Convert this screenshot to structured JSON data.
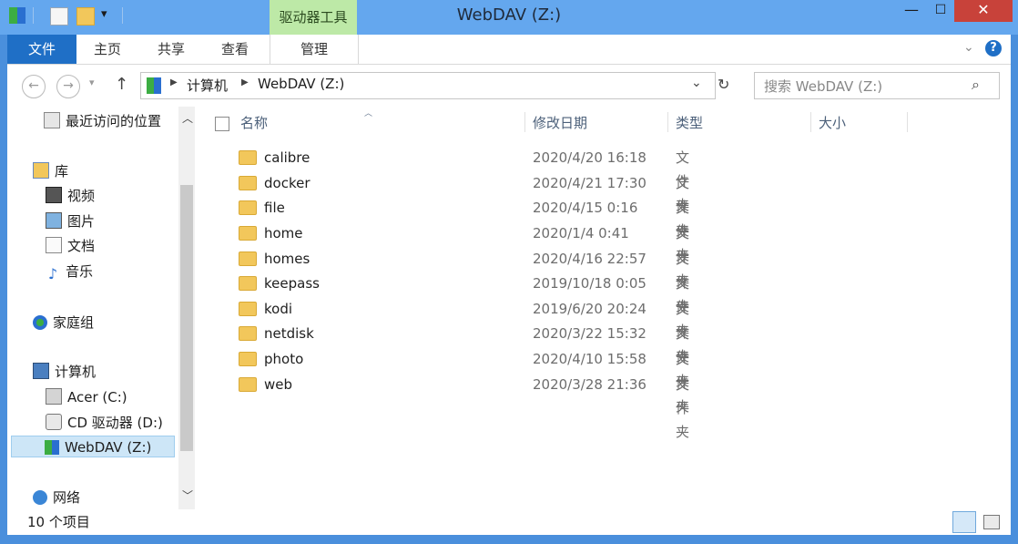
{
  "window": {
    "title": "WebDAV (Z:)",
    "context_tab": "驱动器工具",
    "minimize": "—",
    "maximize": "☐",
    "close": "✕"
  },
  "ribbon": {
    "tabs": [
      "文件",
      "主页",
      "共享",
      "查看",
      "管理"
    ]
  },
  "address": {
    "crumbs": [
      "计算机",
      "WebDAV (Z:)"
    ],
    "search_placeholder": "搜索 WebDAV (Z:)"
  },
  "nav": {
    "items": [
      {
        "label": "最近访问的位置",
        "icon": "recent-places-icon"
      },
      {
        "label": "库",
        "icon": "libraries-icon"
      },
      {
        "label": "视频",
        "icon": "video-icon"
      },
      {
        "label": "图片",
        "icon": "pictures-icon"
      },
      {
        "label": "文档",
        "icon": "documents-icon"
      },
      {
        "label": "音乐",
        "icon": "music-icon"
      },
      {
        "label": "家庭组",
        "icon": "homegroup-icon"
      },
      {
        "label": "计算机",
        "icon": "computer-icon"
      },
      {
        "label": "Acer (C:)",
        "icon": "drive-icon"
      },
      {
        "label": "CD 驱动器 (D:)",
        "icon": "cd-drive-icon"
      },
      {
        "label": "WebDAV (Z:)",
        "icon": "network-drive-icon"
      },
      {
        "label": "网络",
        "icon": "network-icon"
      }
    ]
  },
  "columns": {
    "name": "名称",
    "date": "修改日期",
    "type": "类型",
    "size": "大小"
  },
  "files": [
    {
      "name": "calibre",
      "date": "2020/4/20 16:18",
      "type": "文件夹"
    },
    {
      "name": "docker",
      "date": "2020/4/21 17:30",
      "type": "文件夹"
    },
    {
      "name": "file",
      "date": "2020/4/15 0:16",
      "type": "文件夹"
    },
    {
      "name": "home",
      "date": "2020/1/4 0:41",
      "type": "文件夹"
    },
    {
      "name": "homes",
      "date": "2020/4/16 22:57",
      "type": "文件夹"
    },
    {
      "name": "keepass",
      "date": "2019/10/18 0:05",
      "type": "文件夹"
    },
    {
      "name": "kodi",
      "date": "2019/6/20 20:24",
      "type": "文件夹"
    },
    {
      "name": "netdisk",
      "date": "2020/3/22 15:32",
      "type": "文件夹"
    },
    {
      "name": "photo",
      "date": "2020/4/10 15:58",
      "type": "文件夹"
    },
    {
      "name": "web",
      "date": "2020/3/28 21:36",
      "type": "文件夹"
    }
  ],
  "status": {
    "item_count": "10 个项目"
  },
  "colors": {
    "titlebar": "#64a7ee",
    "file_tab": "#1f6fc6",
    "context_tab": "#bde9a7",
    "close_button": "#c8423a",
    "folder": "#f2c75b"
  }
}
